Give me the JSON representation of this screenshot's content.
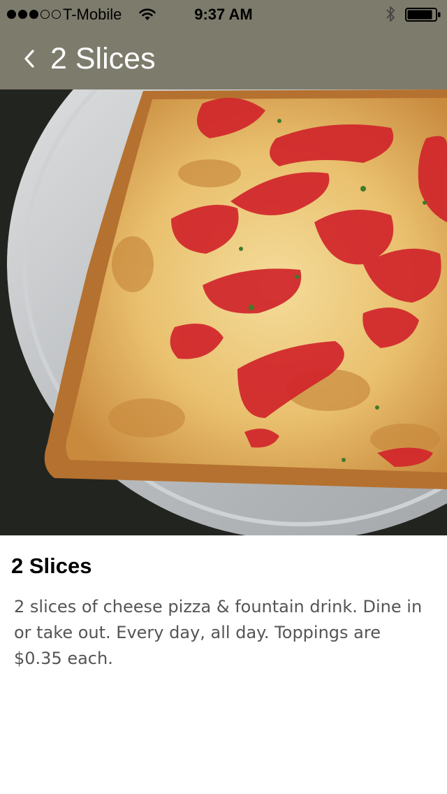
{
  "status_bar": {
    "signal_bars_filled": 3,
    "signal_bars_total": 5,
    "carrier": "T-Mobile",
    "time": "9:37 AM",
    "wifi_icon": "wifi-icon",
    "bluetooth_icon": "bluetooth-icon",
    "battery_icon": "battery-icon",
    "battery_level": 0.9
  },
  "nav": {
    "back_icon": "chevron-left-icon",
    "title": "2 Slices",
    "bar_color": "#7d7b6c"
  },
  "hero": {
    "image_subject": "square cheese pizza with red sauce on a metal tray"
  },
  "item": {
    "title": "2 Slices",
    "description": "2 slices of cheese pizza & fountain drink. Dine in or take out. Every day, all day. Toppings are $0.35 each."
  }
}
